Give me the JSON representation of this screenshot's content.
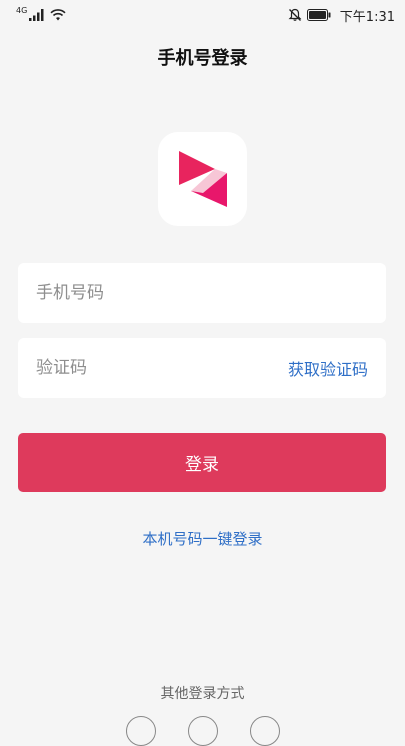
{
  "status_bar": {
    "signal_label": "4G",
    "time": "下午1:31",
    "icons": [
      "signal-icon",
      "wifi-icon",
      "mute-icon",
      "battery-icon"
    ]
  },
  "header": {
    "title": "手机号登录"
  },
  "logo": {
    "icon": "app-logo-icon",
    "colors": {
      "top": "#e8245e",
      "bottom": "#e8176b",
      "stripe": "#f7c6d6"
    }
  },
  "form": {
    "phone_placeholder": "手机号码",
    "code_placeholder": "验证码",
    "get_code_label": "获取验证码",
    "login_label": "登录"
  },
  "links": {
    "one_click_login": "本机号码一键登录"
  },
  "footer": {
    "other_methods_label": "其他登录方式",
    "social_icons": [
      "social-login-icon-1",
      "social-login-icon-2",
      "social-login-icon-3"
    ]
  },
  "colors": {
    "accent": "#de3a5c",
    "link": "#2f6fc7",
    "background": "#f5f5f5"
  }
}
